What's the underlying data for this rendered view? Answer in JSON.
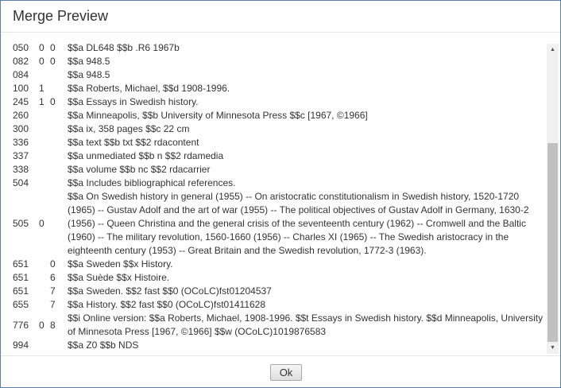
{
  "dialog": {
    "title": "Merge Preview",
    "ok_label": "Ok"
  },
  "icons": {
    "scroll_up": "triangle-up",
    "scroll_down": "triangle-down"
  },
  "records": [
    {
      "tag": "050",
      "ind1": "0",
      "ind2": "0",
      "content": "$$a DL648 $$b .R6 1967b"
    },
    {
      "tag": "082",
      "ind1": "0",
      "ind2": "0",
      "content": "$$a 948.5"
    },
    {
      "tag": "084",
      "ind1": "",
      "ind2": "",
      "content": "$$a 948.5"
    },
    {
      "tag": "100",
      "ind1": "1",
      "ind2": "",
      "content": "$$a Roberts, Michael, $$d 1908-1996."
    },
    {
      "tag": "245",
      "ind1": "1",
      "ind2": "0",
      "content": "$$a Essays in Swedish history."
    },
    {
      "tag": "260",
      "ind1": "",
      "ind2": "",
      "content": "$$a Minneapolis, $$b University of Minnesota Press $$c [1967, ©1966]"
    },
    {
      "tag": "300",
      "ind1": "",
      "ind2": "",
      "content": "$$a ix, 358 pages $$c 22 cm"
    },
    {
      "tag": "336",
      "ind1": "",
      "ind2": "",
      "content": "$$a text $$b txt $$2 rdacontent"
    },
    {
      "tag": "337",
      "ind1": "",
      "ind2": "",
      "content": "$$a unmediated $$b n $$2 rdamedia"
    },
    {
      "tag": "338",
      "ind1": "",
      "ind2": "",
      "content": "$$a volume $$b nc $$2 rdacarrier"
    },
    {
      "tag": "504",
      "ind1": "",
      "ind2": "",
      "content": "$$a Includes bibliographical references."
    },
    {
      "tag": "505",
      "ind1": "0",
      "ind2": "",
      "content": "$$a On Swedish history in general (1955) -- On aristocratic constitutionalism in Swedish history, 1520-1720 (1965) -- Gustav Adolf and the art of war (1955) -- The political objectives of Gustav Adolf in Germany, 1630-2 (1956) -- Queen Christina and the general crisis of the seventeenth century (1962) -- Cromwell and the Baltic (1960) -- The military revolution, 1560-1660 (1956) -- Charles XI (1965) -- The Swedish aristocracy in the eighteenth century (1953) -- Great Britain and the Swedish revolution, 1772-3 (1963)."
    },
    {
      "tag": "651",
      "ind1": "",
      "ind2": "0",
      "content": "$$a Sweden $$x History."
    },
    {
      "tag": "651",
      "ind1": "",
      "ind2": "6",
      "content": "$$a Suède $$x Histoire."
    },
    {
      "tag": "651",
      "ind1": "",
      "ind2": "7",
      "content": "$$a Sweden. $$2 fast $$0 (OCoLC)fst01204537"
    },
    {
      "tag": "655",
      "ind1": "",
      "ind2": "7",
      "content": "$$a History. $$2 fast $$0 (OCoLC)fst01411628"
    },
    {
      "tag": "776",
      "ind1": "0",
      "ind2": "8",
      "content": "$$i Online version: $$a Roberts, Michael, 1908-1996. $$t Essays in Swedish history. $$d Minneapolis, University of Minnesota Press [1967, ©1966] $$w (OCoLC)1019876583"
    },
    {
      "tag": "994",
      "ind1": "",
      "ind2": "",
      "content": "$$a Z0 $$b NDS"
    }
  ]
}
